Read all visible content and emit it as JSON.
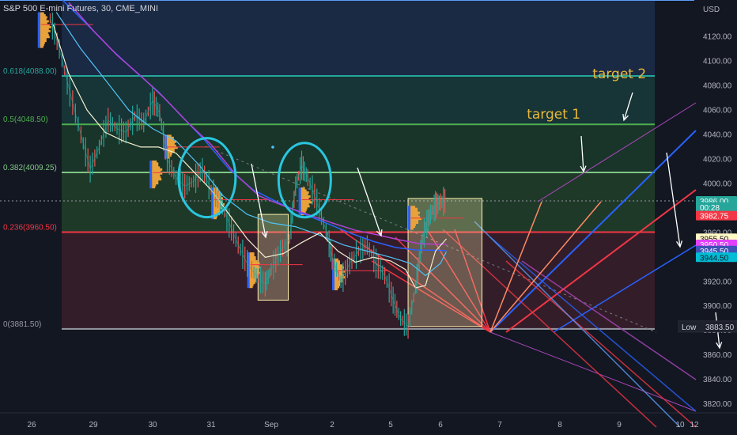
{
  "header": {
    "symbol_title": "S&P 500 E-mini Futures, 30, CME_MINI",
    "currency": "USD"
  },
  "chart_data": {
    "type": "line",
    "title": "S&P 500 E-mini Futures, 30, CME_MINI",
    "ylabel": "USD",
    "ylim": [
      3813,
      4150
    ],
    "y_ticks": [
      4120,
      4100,
      4080,
      4060,
      4040,
      4020,
      4000,
      3980,
      3960,
      3920,
      3900,
      3880,
      3860,
      3840,
      3820
    ],
    "y_tick_labels": [
      "4120.00",
      "4100.00",
      "4080.00",
      "4060.00",
      "4040.00",
      "4020.00",
      "4000.00",
      "3980.00",
      "3960.00",
      "3920.00",
      "3900.00",
      "3880.00",
      "3860.00",
      "3840.00",
      "3820.00"
    ],
    "x_ticks": [
      {
        "label": "26",
        "day": 0
      },
      {
        "label": "29",
        "day": 1
      },
      {
        "label": "30",
        "day": 2
      },
      {
        "label": "31",
        "day": 3
      },
      {
        "label": "Sep",
        "day": 4
      },
      {
        "label": "2",
        "day": 5
      },
      {
        "label": "5",
        "day": 6
      },
      {
        "label": "6",
        "day": 7
      },
      {
        "label": "7",
        "day": 8
      },
      {
        "label": "8",
        "day": 9
      },
      {
        "label": "9",
        "day": 10
      },
      {
        "label": "10",
        "day": 11
      },
      {
        "label": "12",
        "day": 12
      }
    ],
    "fib_levels": [
      {
        "label": "0.618(4088.00)",
        "value": 4088.0,
        "color": "#26a69a"
      },
      {
        "label": "0.5(4048.50)",
        "value": 4048.5,
        "color": "#4caf50"
      },
      {
        "label": "0.382(4009.25)",
        "value": 4009.25,
        "color": "#81c784"
      },
      {
        "label": "0.236(3960.50)",
        "value": 3960.5,
        "color": "#f23645"
      },
      {
        "label": "0(3881.50)",
        "value": 3881.5,
        "color": "#9598a1"
      }
    ],
    "fib_top_line": 4150,
    "price_tags": [
      {
        "text": "3986.00",
        "value": 3986.0,
        "bg": "#26a69a",
        "fg": "#ffffff"
      },
      {
        "text": "00:28",
        "value": 3981.0,
        "bg": "#26a69a",
        "fg": "#ffffff"
      },
      {
        "text": "3982.75",
        "value": 3974.0,
        "bg": "#f23645",
        "fg": "#ffffff"
      },
      {
        "text": "3955.50",
        "value": 3955.5,
        "bg": "#fff9c4",
        "fg": "#131722"
      },
      {
        "text": "3950.50",
        "value": 3950.5,
        "bg": "#e040fb",
        "fg": "#ffffff"
      },
      {
        "text": "3945.50",
        "value": 3945.5,
        "bg": "#3f51b5",
        "fg": "#ffffff"
      },
      {
        "text": "3944.50",
        "value": 3940.0,
        "bg": "#00bcd4",
        "fg": "#131722"
      }
    ],
    "low_label": "Low",
    "low_value": "3883.50",
    "low_price": 3883.5,
    "annotations": [
      {
        "text": "target 2",
        "day": 9.55,
        "value": 4086
      },
      {
        "text": "target 1",
        "day": 8.45,
        "value": 4053
      }
    ],
    "price_series": [
      [
        0.3,
        4135
      ],
      [
        0.45,
        4110
      ],
      [
        0.62,
        4075
      ],
      [
        0.8,
        4040
      ],
      [
        0.95,
        4012
      ],
      [
        1.1,
        4030
      ],
      [
        1.25,
        4052
      ],
      [
        1.4,
        4045
      ],
      [
        1.55,
        4042
      ],
      [
        1.7,
        4055
      ],
      [
        1.85,
        4050
      ],
      [
        2.0,
        4068
      ],
      [
        2.12,
        4058
      ],
      [
        2.25,
        4020
      ],
      [
        2.4,
        4005
      ],
      [
        2.55,
        3998
      ],
      [
        2.7,
        4002
      ],
      [
        2.85,
        4012
      ],
      [
        3.0,
        3995
      ],
      [
        3.15,
        3985
      ],
      [
        3.3,
        3968
      ],
      [
        3.45,
        3950
      ],
      [
        3.6,
        3935
      ],
      [
        3.75,
        3925
      ],
      [
        3.9,
        3918
      ],
      [
        4.0,
        3930
      ],
      [
        4.15,
        3945
      ],
      [
        4.3,
        3955
      ],
      [
        4.4,
        3998
      ],
      [
        4.5,
        4015
      ],
      [
        4.6,
        4005
      ],
      [
        4.75,
        3985
      ],
      [
        4.9,
        3962
      ],
      [
        5.0,
        3940
      ],
      [
        5.15,
        3920
      ],
      [
        5.3,
        3935
      ],
      [
        5.45,
        3945
      ],
      [
        5.6,
        3950
      ],
      [
        5.75,
        3935
      ],
      [
        5.9,
        3925
      ],
      [
        6.05,
        3905
      ],
      [
        6.2,
        3890
      ],
      [
        6.35,
        3883.5
      ],
      [
        6.5,
        3915
      ],
      [
        6.6,
        3945
      ],
      [
        6.7,
        3965
      ],
      [
        6.8,
        3975
      ],
      [
        6.9,
        3982
      ],
      [
        7.0,
        3985
      ],
      [
        7.1,
        3986
      ]
    ],
    "ma_white": [
      [
        0.35,
        4130
      ],
      [
        0.6,
        4090
      ],
      [
        0.9,
        4060
      ],
      [
        1.2,
        4042
      ],
      [
        1.5,
        4035
      ],
      [
        1.8,
        4030
      ],
      [
        2.1,
        4030
      ],
      [
        2.4,
        4025
      ],
      [
        2.7,
        4010
      ],
      [
        3.0,
        3995
      ],
      [
        3.3,
        3975
      ],
      [
        3.6,
        3955
      ],
      [
        3.9,
        3940
      ],
      [
        4.2,
        3943
      ],
      [
        4.5,
        3952
      ],
      [
        4.8,
        3960
      ],
      [
        5.1,
        3945
      ],
      [
        5.4,
        3936
      ],
      [
        5.7,
        3940
      ],
      [
        6.0,
        3937
      ],
      [
        6.3,
        3930
      ],
      [
        6.5,
        3915
      ],
      [
        6.7,
        3917
      ],
      [
        6.9,
        3945
      ],
      [
        7.1,
        3955
      ]
    ],
    "ma_cyan": [
      [
        0.4,
        4140
      ],
      [
        0.8,
        4110
      ],
      [
        1.2,
        4085
      ],
      [
        1.6,
        4060
      ],
      [
        2.0,
        4045
      ],
      [
        2.4,
        4035
      ],
      [
        2.8,
        4015
      ],
      [
        3.2,
        3990
      ],
      [
        3.6,
        3975
      ],
      [
        4.0,
        3968
      ],
      [
        4.4,
        3965
      ],
      [
        4.8,
        3958
      ],
      [
        5.2,
        3950
      ],
      [
        5.6,
        3945
      ],
      [
        6.0,
        3940
      ],
      [
        6.4,
        3935
      ],
      [
        6.7,
        3925
      ],
      [
        7.0,
        3935
      ],
      [
        7.1,
        3944.5
      ]
    ],
    "ma_magenta": [
      [
        0.6,
        4148
      ],
      [
        1.0,
        4125
      ],
      [
        1.4,
        4105
      ],
      [
        1.8,
        4088
      ],
      [
        2.2,
        4070
      ],
      [
        2.6,
        4050
      ],
      [
        3.0,
        4032
      ],
      [
        3.4,
        4008
      ],
      [
        3.8,
        3990
      ],
      [
        4.2,
        3982
      ],
      [
        4.6,
        3975
      ],
      [
        5.0,
        3968
      ],
      [
        5.4,
        3962
      ],
      [
        5.8,
        3958
      ],
      [
        6.2,
        3954
      ],
      [
        6.6,
        3951
      ],
      [
        7.1,
        3950.5
      ]
    ],
    "ma_blue": [
      [
        0.5,
        4150
      ],
      [
        0.9,
        4130
      ],
      [
        1.3,
        4110
      ],
      [
        1.7,
        4092
      ],
      [
        2.1,
        4075
      ],
      [
        2.5,
        4055
      ],
      [
        2.9,
        4035
      ],
      [
        3.3,
        4012
      ],
      [
        3.7,
        3995
      ],
      [
        4.1,
        3985
      ],
      [
        4.5,
        3976
      ],
      [
        4.9,
        3968
      ],
      [
        5.3,
        3960
      ],
      [
        5.7,
        3953
      ],
      [
        6.1,
        3948
      ],
      [
        6.5,
        3946
      ],
      [
        7.1,
        3945.5
      ]
    ],
    "boxes": [
      {
        "day0": 3.78,
        "day1": 4.28,
        "v0": 3975,
        "v1": 3905,
        "color": "#fff3b0"
      },
      {
        "day0": 6.35,
        "day1": 7.7,
        "v0": 3988,
        "v1": 3883.5,
        "color": "#fff3b0"
      }
    ],
    "circles": [
      {
        "day": 2.93,
        "value": 4005,
        "rx": 36,
        "ry": 50
      },
      {
        "day": 4.55,
        "value": 4003,
        "rx": 33,
        "ry": 47
      }
    ],
    "grid": false,
    "legend": "none"
  }
}
